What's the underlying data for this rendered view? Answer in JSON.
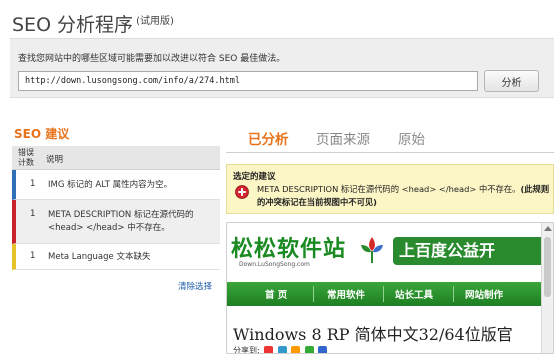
{
  "header": {
    "title": "SEO 分析程序",
    "badge": "(试用版)"
  },
  "url_panel": {
    "prompt": "查找您网站中的哪些区域可能需要加以改进以符合 SEO 最佳做法。",
    "url_value": "http://down.lusongsong.com/info/a/274.html",
    "analyze_label": "分析"
  },
  "suggestions": {
    "title": "SEO 建议",
    "header_count": "错误计数",
    "header_desc": "说明",
    "rows": [
      {
        "count": "1",
        "desc": "IMG 标记的 ALT 属性内容为空。",
        "severity_color": "#2f6fb5"
      },
      {
        "count": "1",
        "desc": "META DESCRIPTION 标记在源代码的 <head> </head> 中不存在。",
        "severity_color": "#c8232b"
      },
      {
        "count": "1",
        "desc": "Meta Language 文本缺失",
        "severity_color": "#e8c22a"
      }
    ],
    "clear_label": "清除选择"
  },
  "tabs": [
    {
      "label": "已分析",
      "active": true
    },
    {
      "label": "页面来源",
      "active": false
    },
    {
      "label": "原始",
      "active": false
    }
  ],
  "notice": {
    "title": "选定的建议",
    "icon": "error-plus-icon",
    "text": "META DESCRIPTION 标记在源代码的 <head> </head> 中不存在。",
    "bold_text": "(此规则的冲突标记在当前视图中不可见)"
  },
  "preview": {
    "logo": "松松软件站",
    "logo_sub": "Down.LuSongSong.com",
    "charity": "上百度公益开",
    "nav": [
      "首 页",
      "常用软件",
      "站长工具",
      "网站制作"
    ],
    "headline": "Windows 8 RP 简体中文32/64位版官",
    "share_label": "分享到:"
  },
  "colors": {
    "accent": "#e8731a",
    "link": "#1f5fa8",
    "nav_green": "#2a8a2e"
  }
}
